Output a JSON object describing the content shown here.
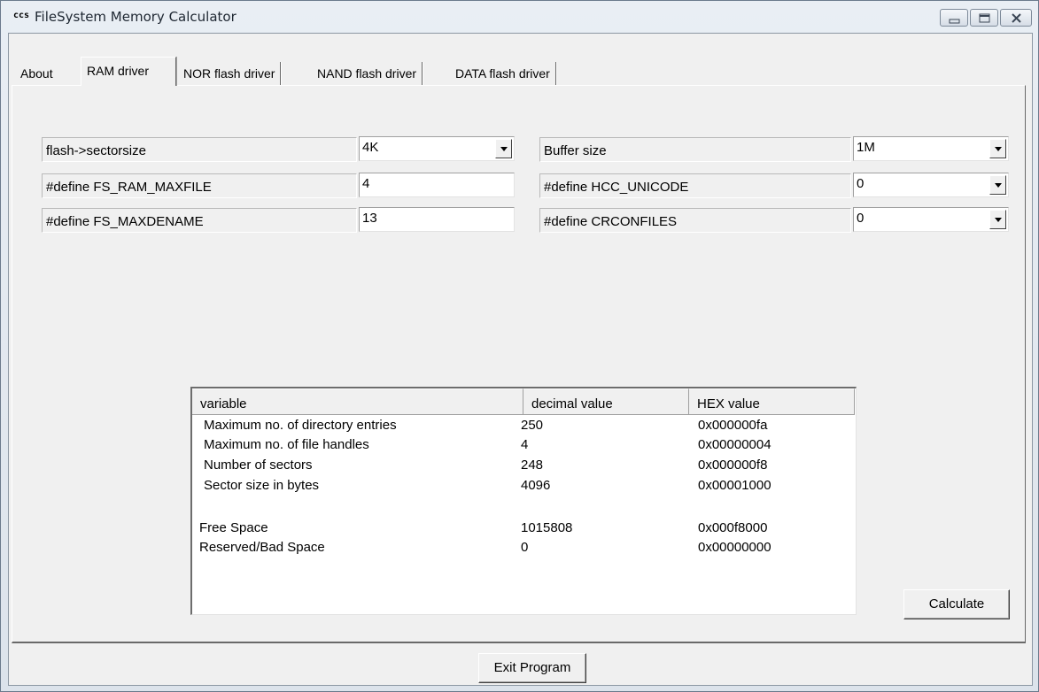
{
  "window": {
    "title": "FileSystem Memory Calculator",
    "app_icon": "ccs"
  },
  "tabs": [
    "About",
    "RAM driver",
    "NOR flash driver",
    "NAND flash driver",
    "DATA flash driver"
  ],
  "active_tab": "RAM driver",
  "left_params": [
    {
      "label": "flash->sectorsize",
      "value": "4K",
      "control": "combo"
    },
    {
      "label": "#define FS_RAM_MAXFILE",
      "value": "4",
      "control": "edit"
    },
    {
      "label": "#define FS_MAXDENAME",
      "value": "13",
      "control": "edit"
    }
  ],
  "right_params": [
    {
      "label": "Buffer size",
      "value": "1M",
      "control": "combo"
    },
    {
      "label": "#define HCC_UNICODE",
      "value": "0",
      "control": "combo"
    },
    {
      "label": "#define CRCONFILES",
      "value": "0",
      "control": "combo"
    }
  ],
  "results": {
    "columns": [
      "variable",
      "decimal value",
      "HEX value"
    ],
    "rows": [
      {
        "variable": "Maximum no. of directory entries",
        "decimal": "250",
        "hex": "0x000000fa"
      },
      {
        "variable": "Maximum no. of file handles",
        "decimal": "4",
        "hex": "0x00000004"
      },
      {
        "variable": "Number of sectors",
        "decimal": "248",
        "hex": "0x000000f8"
      },
      {
        "variable": "Sector size in bytes",
        "decimal": "4096",
        "hex": "0x00001000"
      },
      {
        "variable": "Free Space",
        "decimal": "1015808",
        "hex": "0x000f8000"
      },
      {
        "variable": "Reserved/Bad Space",
        "decimal": "0",
        "hex": "0x00000000"
      }
    ]
  },
  "buttons": {
    "calculate": "Calculate",
    "exit": "Exit Program"
  }
}
